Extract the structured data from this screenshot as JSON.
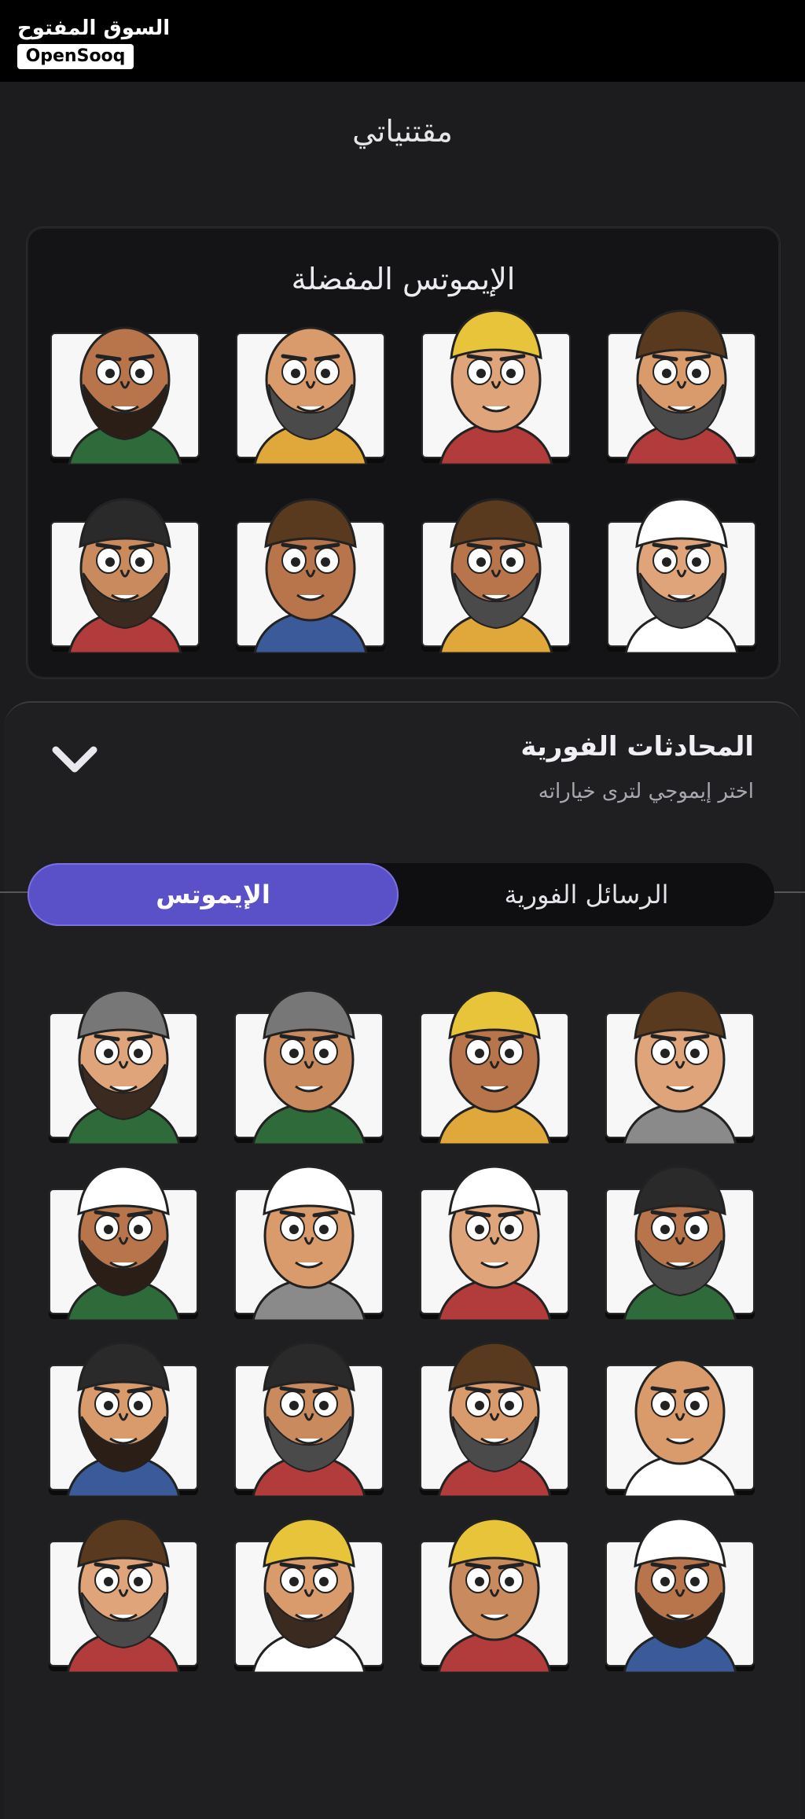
{
  "brand": {
    "name_ar": "السوق المفتوح",
    "name_en": "OpenSooq"
  },
  "page": {
    "title": "مقتنياتي"
  },
  "favorites": {
    "title": "الإيموتس المفضلة",
    "items": [
      "jester-icon",
      "mustache-man-icon",
      "heart-eyes-woman-icon",
      "tank-top-man-icon",
      "sunglasses-bald-man-icon",
      "woman-phone-icon",
      "megaphone-man-icon",
      "crying-gulf-man-icon"
    ]
  },
  "chat_sheet": {
    "title": "المحادثات الفورية",
    "subtitle": "اختر إيموجي لترى خياراته",
    "tabs": [
      {
        "label": "الرسائل الفورية",
        "active": false
      },
      {
        "label": "الإيموتس",
        "active": true
      }
    ],
    "emojis": [
      "green-face-man-icon",
      "flag-hand-icon",
      "laughing-pointing-man-icon",
      "winking-beanie-man-icon",
      "beanie-grin-man-icon",
      "phone-call-icon",
      "worried-pray-man-icon",
      "angry-fez-man-icon",
      "shocked-woman-icon",
      "officer-man-icon",
      "nervous-headband-man-icon",
      "weightlifter-phone-man-icon",
      "woman-pointing-icon",
      "thumbs-down-group-icon",
      "sad-gulf-man-icon",
      "facepalm-jester-icon"
    ]
  },
  "colors": {
    "accent": "#5a50c8",
    "background": "#1c1c1e",
    "card": "#141416"
  }
}
